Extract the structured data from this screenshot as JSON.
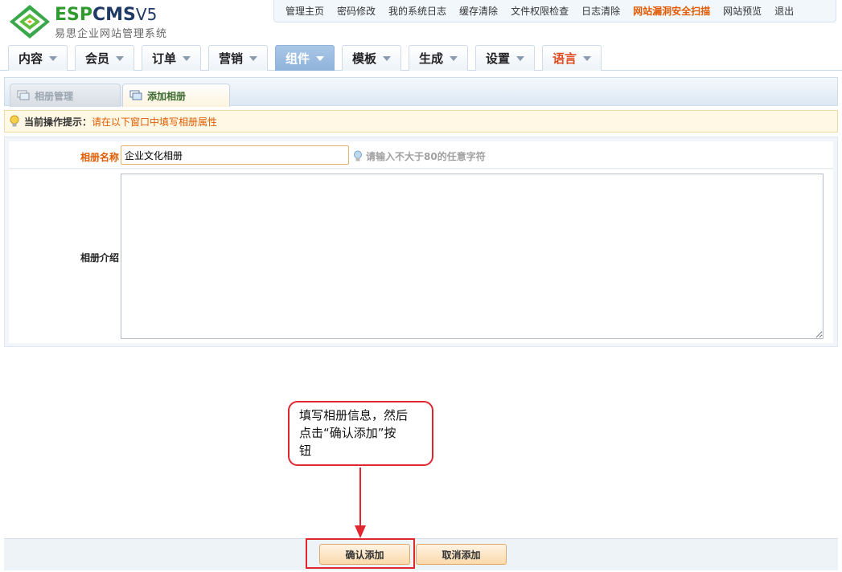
{
  "logo": {
    "brand_esp": "ESP",
    "brand_cms": "CMS",
    "brand_ver": "V5",
    "subtitle": "易思企业网站管理系统"
  },
  "topbar": {
    "links": [
      "管理主页",
      "密码修改",
      "我的系统日志",
      "缓存清除",
      "文件权限检查",
      "日志清除",
      "网站漏洞安全扫描",
      "网站预览",
      "退出"
    ]
  },
  "nav": {
    "tabs": [
      "内容",
      "会员",
      "订单",
      "营销",
      "组件",
      "模板",
      "生成",
      "设置",
      "语言"
    ],
    "active": "组件"
  },
  "subtabs": {
    "album_manage": "相册管理",
    "add_album": "添加相册"
  },
  "hint": {
    "label": "当前操作提示：",
    "message": "请在以下窗口中填写相册属性"
  },
  "form": {
    "name_label": "相册名称",
    "name_value": "企业文化相册",
    "name_tip": "请输入不大于80的任意字符",
    "desc_label": "相册介绍",
    "desc_value": ""
  },
  "callout": {
    "line1": "填写相册信息，然后",
    "line2": "点击“确认添加”按",
    "line3": "钮"
  },
  "buttons": {
    "confirm": "确认添加",
    "cancel": "取消添加"
  },
  "colors": {
    "accent_orange": "#e05a00",
    "annotation_red": "#e0262e",
    "nav_active": "#8fb3db"
  }
}
